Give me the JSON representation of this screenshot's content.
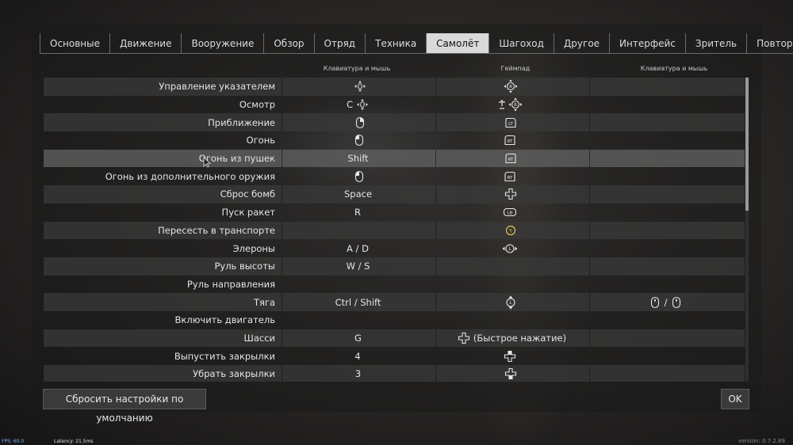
{
  "tabs": [
    {
      "label": "Основные"
    },
    {
      "label": "Движение"
    },
    {
      "label": "Вооружение"
    },
    {
      "label": "Обзор"
    },
    {
      "label": "Отряд"
    },
    {
      "label": "Техника"
    },
    {
      "label": "Самолёт",
      "active": true
    },
    {
      "label": "Шагоход"
    },
    {
      "label": "Другое"
    },
    {
      "label": "Интерфейс"
    },
    {
      "label": "Зритель"
    },
    {
      "label": "Повтор"
    }
  ],
  "columns": {
    "c1": "Клавиатура и мышь",
    "c2": "Геймпад",
    "c3": "Клавиатура и мышь"
  },
  "rows": [
    {
      "name": "Управление указателем",
      "c1": "",
      "c1_icon": "mouse-move-icon",
      "c2": "",
      "c2_icon": "stick-right-icon",
      "c3": ""
    },
    {
      "name": "Осмотр",
      "c1": "C",
      "c1_icon": "mouse-move-icon",
      "c2": "",
      "c2_icon": "button-plus-stick-icon",
      "c3": ""
    },
    {
      "name": "Приближение",
      "c1": "",
      "c1_icon": "mouse-right-icon",
      "c2": "",
      "c2_icon": "lt-trigger-icon",
      "c3": ""
    },
    {
      "name": "Огонь",
      "c1": "",
      "c1_icon": "mouse-left-icon",
      "c2": "",
      "c2_icon": "rt-trigger-icon",
      "c3": ""
    },
    {
      "name": "Огонь из пушек",
      "c1": "Shift",
      "c1_icon": "",
      "c2": "",
      "c2_icon": "rt-trigger-icon",
      "c3": ""
    },
    {
      "name": "Огонь из дополнительного оружия",
      "c1": "",
      "c1_icon": "mouse-left-icon",
      "c2": "",
      "c2_icon": "rt-trigger-icon",
      "c3": ""
    },
    {
      "name": "Сброс бомб",
      "c1": "Space",
      "c1_icon": "",
      "c2": "",
      "c2_icon": "dpad-icon",
      "c3": ""
    },
    {
      "name": "Пуск ракет",
      "c1": "R",
      "c1_icon": "",
      "c2": "",
      "c2_icon": "lb-bumper-icon",
      "c3": ""
    },
    {
      "name": "Пересесть в транспорте",
      "c1": "",
      "c1_icon": "",
      "c2": "",
      "c2_icon": "y-button-icon",
      "c3": ""
    },
    {
      "name": "Элероны",
      "c1": "A / D",
      "c1_icon": "",
      "c2": "",
      "c2_icon": "stick-left-horizontal-icon",
      "c3": ""
    },
    {
      "name": "Руль высоты",
      "c1": "W / S",
      "c1_icon": "",
      "c2": "",
      "c2_icon": "",
      "c3": ""
    },
    {
      "name": "Руль направления",
      "c1": "",
      "c1_icon": "",
      "c2": "",
      "c2_icon": "",
      "c3": ""
    },
    {
      "name": "Тяга",
      "c1": "Ctrl / Shift",
      "c1_icon": "",
      "c2": "",
      "c2_icon": "stick-left-vertical-icon",
      "c3": "/",
      "c3_icon": "mouse-wheel-icon"
    },
    {
      "name": "Включить двигатель",
      "c1": "",
      "c1_icon": "",
      "c2": "",
      "c2_icon": "",
      "c3": ""
    },
    {
      "name": "Шасси",
      "c1": "G",
      "c1_icon": "",
      "c2": "(Быстрое нажатие)",
      "c2_icon": "dpad-icon",
      "c3": ""
    },
    {
      "name": "Выпустить закрылки",
      "c1": "4",
      "c1_icon": "",
      "c2": "",
      "c2_icon": "dpad-up-icon",
      "c3": ""
    },
    {
      "name": "Убрать закрылки",
      "c1": "3",
      "c1_icon": "",
      "c2": "",
      "c2_icon": "dpad-down-icon",
      "c3": ""
    }
  ],
  "buttons": {
    "reset": "Сбросить настройки по умолчанию",
    "ok": "OK"
  },
  "overlay": {
    "fps": "FPS: 60.0",
    "latency": "Latency:  21.5ms",
    "version": "version: 0.7.2.89"
  }
}
